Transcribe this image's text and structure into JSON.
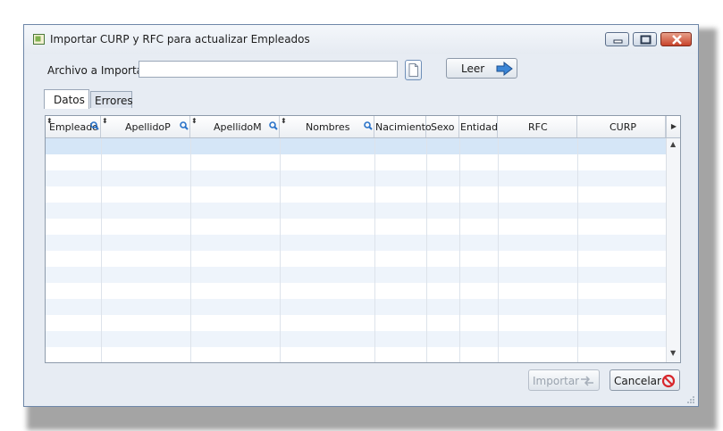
{
  "window": {
    "title": "Importar CURP y RFC para actualizar Empleados"
  },
  "file_row": {
    "label": "Archivo a Importar:",
    "value": "",
    "placeholder": "",
    "read_button_label": "Leer"
  },
  "tabs": [
    {
      "label": "Datos",
      "active": true
    },
    {
      "label": "Errores",
      "active": false
    }
  ],
  "grid": {
    "columns": [
      {
        "label": "Empleado",
        "sortable": true,
        "searchable": true
      },
      {
        "label": "ApellidoP",
        "sortable": true,
        "searchable": true
      },
      {
        "label": "ApellidoM",
        "sortable": true,
        "searchable": true
      },
      {
        "label": "Nombres",
        "sortable": true,
        "searchable": true
      },
      {
        "label": "Nacimiento",
        "sortable": false,
        "searchable": false
      },
      {
        "label": "Sexo",
        "sortable": false,
        "searchable": false
      },
      {
        "label": "Entidad",
        "sortable": false,
        "searchable": false
      },
      {
        "label": "RFC",
        "sortable": false,
        "searchable": false
      },
      {
        "label": "CURP",
        "sortable": false,
        "searchable": false
      }
    ],
    "rows": []
  },
  "buttons": {
    "import_label": "Importar",
    "import_enabled": false,
    "cancel_label": "Cancelar"
  },
  "icons": {
    "app": "app-icon",
    "file": "document-icon",
    "read": "arrow-right-icon",
    "import": "transfer-arrows-icon",
    "cancel": "no-entry-icon",
    "search": "magnifier-icon"
  },
  "colors": {
    "accent": "#2a73c9",
    "close_button": "#c7432b",
    "cancel_icon": "#d8262b",
    "row_alt": "#eef4fb",
    "row_selected": "#d5e6f7"
  }
}
